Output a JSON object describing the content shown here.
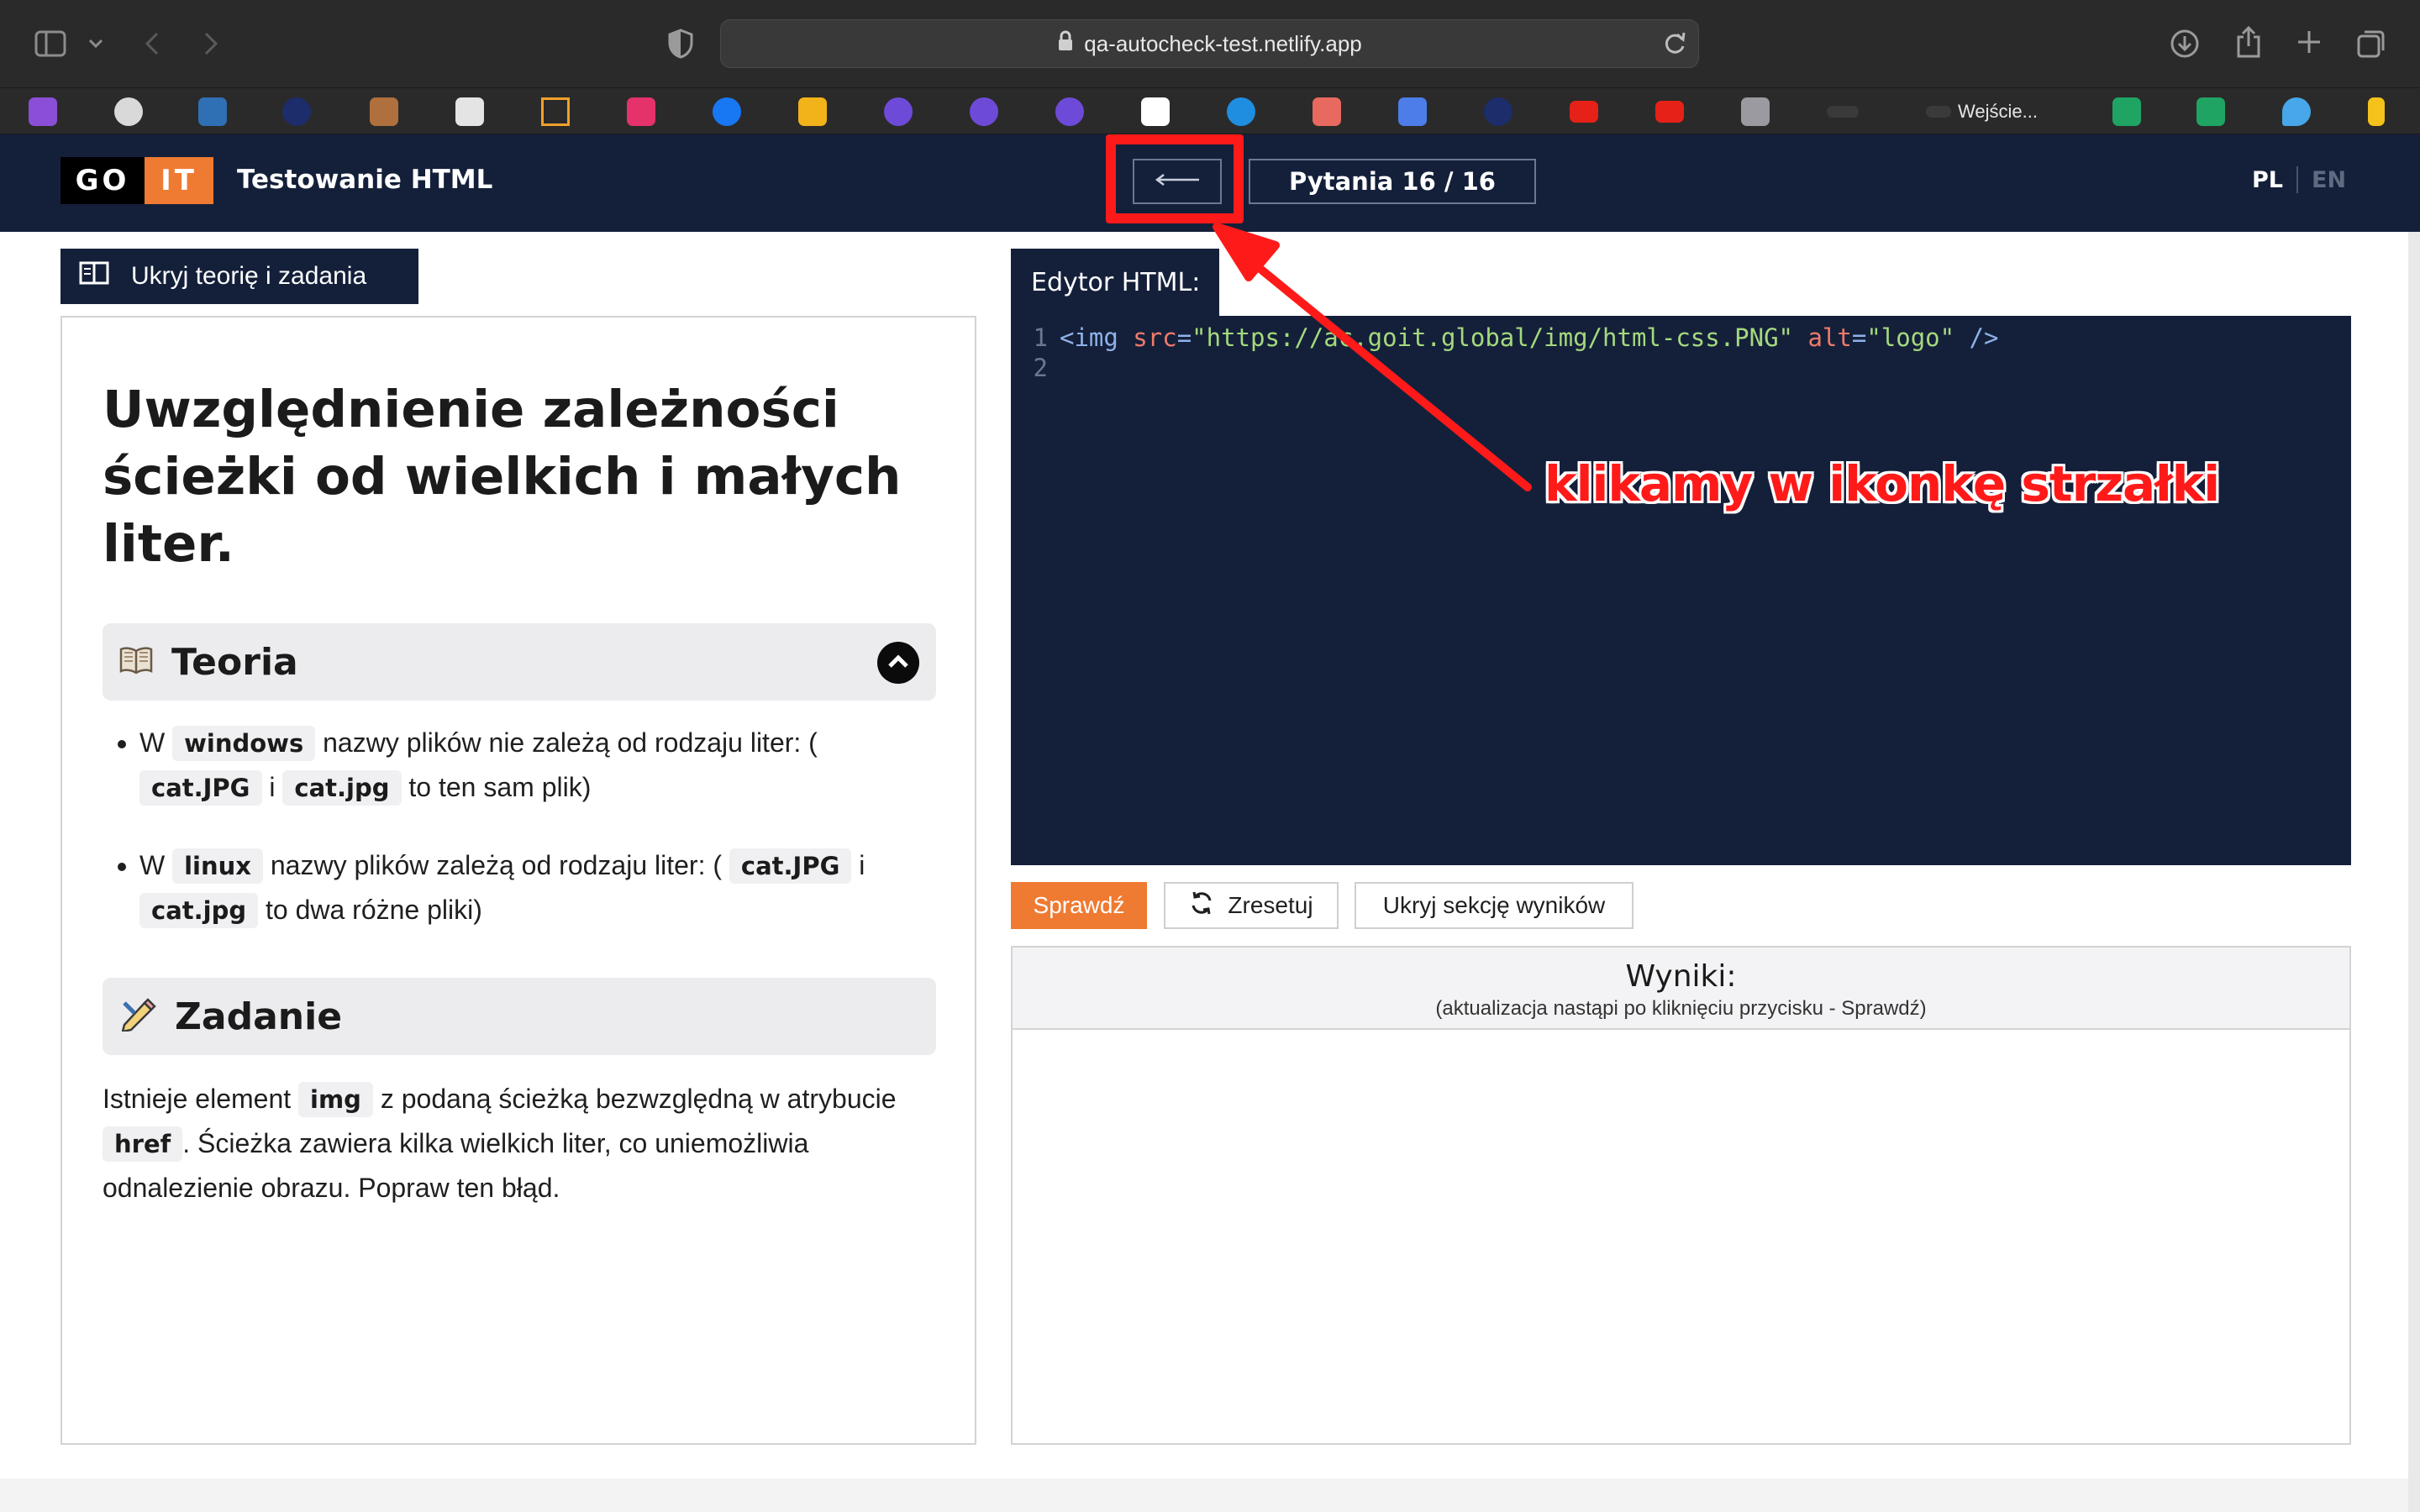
{
  "browser": {
    "url": "qa-autocheck-test.netlify.app",
    "active_tab_label": "Wejście...",
    "bookmarks": [
      "onion",
      "tofu",
      "linkedin",
      "p",
      "image",
      "tablet",
      "triangle",
      "stack",
      "facebook",
      "star",
      "proton",
      "proton",
      "proton",
      "mailer",
      "u",
      "openai",
      "translate",
      "p",
      "youtube",
      "youtube",
      "T",
      "banner",
      "banner",
      "sheets",
      "sheets",
      "drop",
      "bolt"
    ]
  },
  "header": {
    "logo_left": "GO",
    "logo_right": "IT",
    "title": "Testowanie HTML",
    "counter": "Pytania 16 / 16",
    "lang_active": "PL",
    "lang_inactive": "EN"
  },
  "left": {
    "toggle_label": "Ukryj teorię i zadania",
    "title": "Uwzględnienie zależności ścieżki od wielkich i małych liter.",
    "theory_title": "Teoria",
    "task_title": "Zadanie",
    "theory": {
      "b1_pre": "W",
      "b1_code": "windows",
      "b1_mid": "nazwy plików nie zależą od rodzaju liter: (",
      "b1_code2": "cat.JPG",
      "b1_i": "i",
      "b1_code3": "cat.jpg",
      "b1_end": "to ten sam plik)",
      "b2_pre": "W",
      "b2_code": "linux",
      "b2_mid": "nazwy plików zależą od rodzaju liter: (",
      "b2_code2": "cat.JPG",
      "b2_i": "i",
      "b2_code3": "cat.jpg",
      "b2_end": "to dwa różne pliki)"
    },
    "task": {
      "t1": "Istnieje element",
      "code1": "img",
      "t2": "z podaną ścieżką bezwzględną w atrybucie",
      "code2": "href",
      "t3": ". Ścieżka zawiera kilka wielkich liter, co uniemożliwia odnalezienie obrazu. Popraw ten błąd."
    }
  },
  "editor": {
    "tab_label": "Edytor HTML:",
    "line1": {
      "num": "1",
      "open": "<img",
      "attr1": " src",
      "eq1": "=",
      "val1": "\"https://ac.goit.global/img/html-css.PNG\"",
      "attr2": " alt",
      "eq2": "=",
      "val2": "\"logo\"",
      "close": " />"
    },
    "line2": {
      "num": "2"
    }
  },
  "actions": {
    "check": "Sprawdź",
    "reset": "Zresetuj",
    "hide_results": "Ukryj sekcję wyników"
  },
  "results": {
    "title": "Wyniki:",
    "note": "(aktualizacja nastąpi po kliknięciu przycisku - Sprawdź)"
  },
  "annotation": {
    "text": "klikamy w ikonkę strzałki",
    "color": "#ff1a1a"
  },
  "colors": {
    "header_bg": "#14203a",
    "accent_orange": "#ef7a32"
  }
}
